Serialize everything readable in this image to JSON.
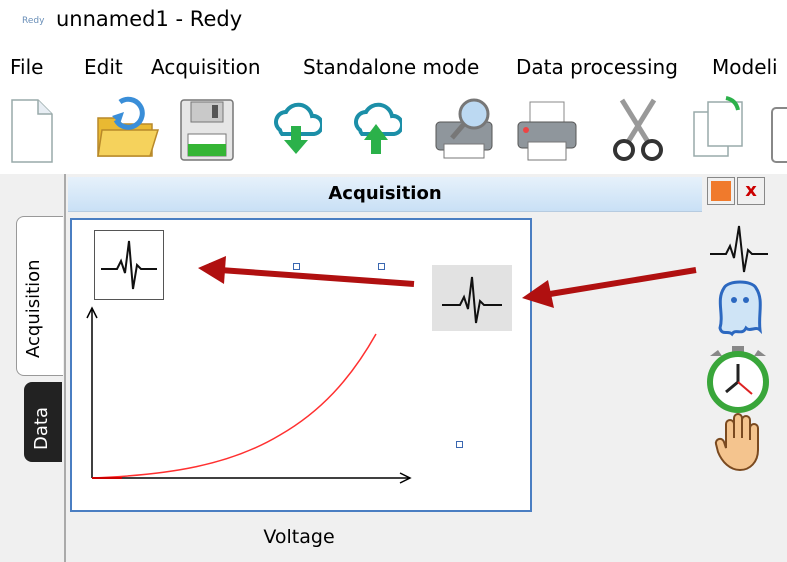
{
  "window": {
    "title": "unnamed1 - Redy",
    "app_icon_text": "Redy"
  },
  "menu": [
    {
      "label": "File"
    },
    {
      "label": "Edit"
    },
    {
      "label": "Acquisition"
    },
    {
      "label": "Standalone mode"
    },
    {
      "label": "Data processing"
    },
    {
      "label": "Modeli"
    }
  ],
  "toolbar": [
    {
      "icon": "new-document-icon"
    },
    {
      "icon": "open-folder-icon"
    },
    {
      "icon": "save-disk-icon"
    },
    {
      "icon": "cloud-download-icon"
    },
    {
      "icon": "cloud-upload-icon"
    },
    {
      "icon": "print-preview-icon"
    },
    {
      "icon": "printer-icon"
    },
    {
      "icon": "scissors-cut-icon"
    },
    {
      "icon": "copy-icon"
    },
    {
      "icon": "paste-icon"
    }
  ],
  "panel": {
    "title": "Acquisition",
    "close_symbol": "x",
    "tabs": [
      {
        "label": "Acquisition"
      },
      {
        "label": "Data"
      }
    ],
    "axis_label": "Voltage"
  },
  "palette": [
    {
      "icon": "ecg-signal-icon"
    },
    {
      "icon": "ghost-icon"
    },
    {
      "icon": "stopwatch-icon"
    },
    {
      "icon": "stop-hand-icon"
    }
  ],
  "colors": {
    "canvas_border": "#4a7ec2",
    "curve": "#ff3030",
    "arrow": "#b01010",
    "close_x": "#cc0000",
    "orange_button": "#f07a2c"
  }
}
